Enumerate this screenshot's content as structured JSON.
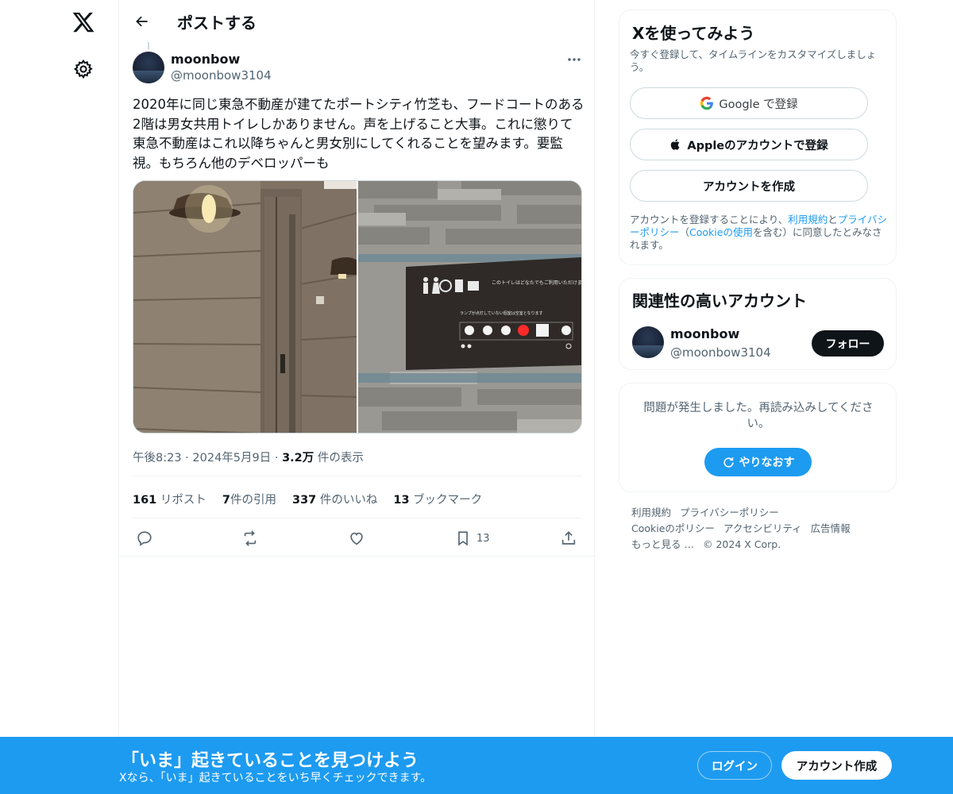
{
  "nav": {
    "logo_icon": "x-logo-icon",
    "settings_icon": "gear-icon"
  },
  "header": {
    "title": "ポストする"
  },
  "post": {
    "author_name": "moonbow",
    "author_handle": "@moonbow3104",
    "text": "2020年に同じ東急不動産が建てたポートシティ竹芝も、フードコートのある2階は男女共用トイレしかありません。声を上げること大事。これに懲りて東急不動産はこれ以降ちゃんと男女別にしてくれることを望みます。要監視。もちろん他のデベロッパーも",
    "sign_text": "このトイレはどなたでもご利用いただけます",
    "sign_subtext": "ランプが点灯していない個室は空室となります",
    "time": "午後8:23",
    "date": "2024年5月9日",
    "views_count": "3.2万",
    "views_label": "件の表示",
    "stats": [
      {
        "count": "161",
        "label": "リポスト"
      },
      {
        "count": "7",
        "label": "件の引用"
      },
      {
        "count": "337",
        "label": "件のいいね"
      },
      {
        "count": "13",
        "label": "ブックマーク"
      }
    ],
    "bookmark_count": "13"
  },
  "signup_card": {
    "title": "Xを使ってみよう",
    "subtitle": "今すぐ登録して、タイムラインをカスタマイズしましょう。",
    "google_label": "Google で登録",
    "apple_label": "Appleのアカウントで登録",
    "create_label": "アカウントを作成",
    "terms_1": "アカウントを登録することにより、",
    "terms_link_1": "利用規約",
    "terms_2": "と",
    "terms_link_2": "プライバシーポリシー",
    "terms_3": "（",
    "terms_link_3": "Cookieの使用",
    "terms_4": "を含む）に同意したとみなされます。"
  },
  "related_card": {
    "title": "関連性の高いアカウント",
    "name": "moonbow",
    "handle": "@moonbow3104",
    "follow_label": "フォロー"
  },
  "error_card": {
    "message": "問題が発生しました。再読み込みしてください。",
    "retry_label": "やりなおす"
  },
  "footer": {
    "links": [
      "利用規約",
      "プライバシーポリシー",
      "Cookieのポリシー",
      "アクセシビリティ",
      "広告情報",
      "もっと見る …",
      "© 2024 X Corp."
    ]
  },
  "banner": {
    "title": "「いま」起きていることを見つけよう",
    "subtitle": "Xなら、「いま」起きていることをいち早くチェックできます。",
    "login_label": "ログイン",
    "signup_label": "アカウント作成"
  },
  "colors": {
    "accent": "#1d9bf0",
    "text": "#0f1419",
    "muted": "#536471",
    "border": "#eff3f4"
  }
}
